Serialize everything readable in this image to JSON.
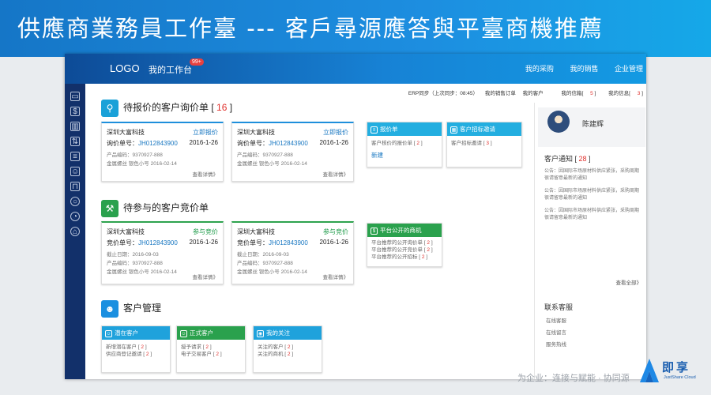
{
  "slide_title": "供應商業務員工作臺 --- 客戶尋源應答與平臺商機推薦",
  "topbar": {
    "logo": "LOGO",
    "workspace": "我的工作台",
    "badge": "99+",
    "nav": [
      "我的采购",
      "我的销售",
      "企业管理"
    ]
  },
  "subbar": {
    "erp_sync": "ERP同步（上次同步：08:45）",
    "sales_orders": "我的销售订单",
    "my_customers": "我的客户",
    "credit_label": "我的信箱",
    "credit_count": "5",
    "messages_label": "我的信息",
    "messages_count": "3"
  },
  "sidebar_icons": [
    "briefcase-icon",
    "coin-icon",
    "map-icon",
    "exchange-icon",
    "document-icon",
    "team-icon",
    "bag-icon",
    "search-icon",
    "chart-icon",
    "user-icon"
  ],
  "inquiry": {
    "title": "待报价的客户询价单",
    "count": "16",
    "cards": [
      {
        "company": "深圳大富科技",
        "action": "立即报价",
        "no_label": "询价单号：",
        "no": "JH012843900",
        "date": "2016-1-26",
        "product": "产品编码：9370927-888",
        "meta": "金属螺丝  银色小号  2016-02-14",
        "detail": "查看详情》"
      },
      {
        "company": "深圳大富科技",
        "action": "立即报价",
        "no_label": "询价单号：",
        "no": "JH012843900",
        "date": "2016-1-26",
        "product": "产品编码：9370927-888",
        "meta": "金属螺丝  银色小号  2016-02-14",
        "detail": "查看详情》"
      }
    ],
    "mini1": {
      "title": "报价单",
      "line": "客户核价的报价单",
      "count": "2",
      "link": "新建"
    },
    "mini2": {
      "title": "客户招标邀请",
      "line": "客户招标邀请",
      "count": "3"
    }
  },
  "bidding": {
    "title": "待参与的客户竞价单",
    "cards": [
      {
        "company": "深圳大富科技",
        "action": "参与竞价",
        "no_label": "竞价单号：",
        "no": "JH012843900",
        "date": "2016-1-26",
        "deadline": "截止日期：2016-09-03",
        "product": "产品编码：9370927-888",
        "meta": "金属螺丝  银色小号  2016-02-14",
        "detail": "查看详情》"
      },
      {
        "company": "深圳大富科技",
        "action": "参与竞价",
        "no_label": "竞价单号：",
        "no": "JH012843900",
        "date": "2016-1-26",
        "deadline": "截止日期：2016-09-03",
        "product": "产品编码：9370927-888",
        "meta": "金属螺丝  银色小号  2016-02-14",
        "detail": "查看详情》"
      }
    ],
    "mini": {
      "title": "平台公开的商机",
      "lines": [
        {
          "label": "平台推荐的公开询价单",
          "count": "2"
        },
        {
          "label": "平台推荐的公开竞价单",
          "count": "2"
        },
        {
          "label": "平台推荐的公开招标",
          "count": "2"
        }
      ]
    }
  },
  "customers": {
    "title": "客户管理",
    "boxes": [
      {
        "title": "潜在客户",
        "lines": [
          {
            "label": "新增潜在客户",
            "count": "2"
          },
          {
            "label": "供应商登记邀请",
            "count": "2"
          }
        ]
      },
      {
        "title": "正式客户",
        "lines": [
          {
            "label": "授予请求",
            "count": "2"
          },
          {
            "label": "电子交易客户",
            "count": "2"
          }
        ]
      },
      {
        "title": "我的关注",
        "lines": [
          {
            "label": "关注的客户",
            "count": "2"
          },
          {
            "label": "关注的商机",
            "count": "2"
          }
        ]
      }
    ]
  },
  "right_panel": {
    "name": "陈建辉",
    "notice_title": "客户通知",
    "notice_count": "28",
    "notices": [
      "公告：因国际市场原材料供应紧张，采购周期很请留意最新的通知",
      "公告：因国际市场原材料供应紧张，采购周期很请留意最新的通知",
      "公告：因国际市场原材料供应紧张，采购周期很请留意最新的通知"
    ],
    "view_all": "查看全部》",
    "service_title": "联系客服",
    "service_items": [
      "在线客服",
      "在线留言",
      "服务热线"
    ]
  },
  "footer_text": "为企业：连接与赋能 · 协同源",
  "brand": {
    "name": "即享",
    "sub": "JustShare Cloud"
  },
  "colors": {
    "inquiry_icon": "#1aa1d8",
    "bid_icon": "#2aa14d",
    "cust_icon": "#1a8fe0"
  }
}
